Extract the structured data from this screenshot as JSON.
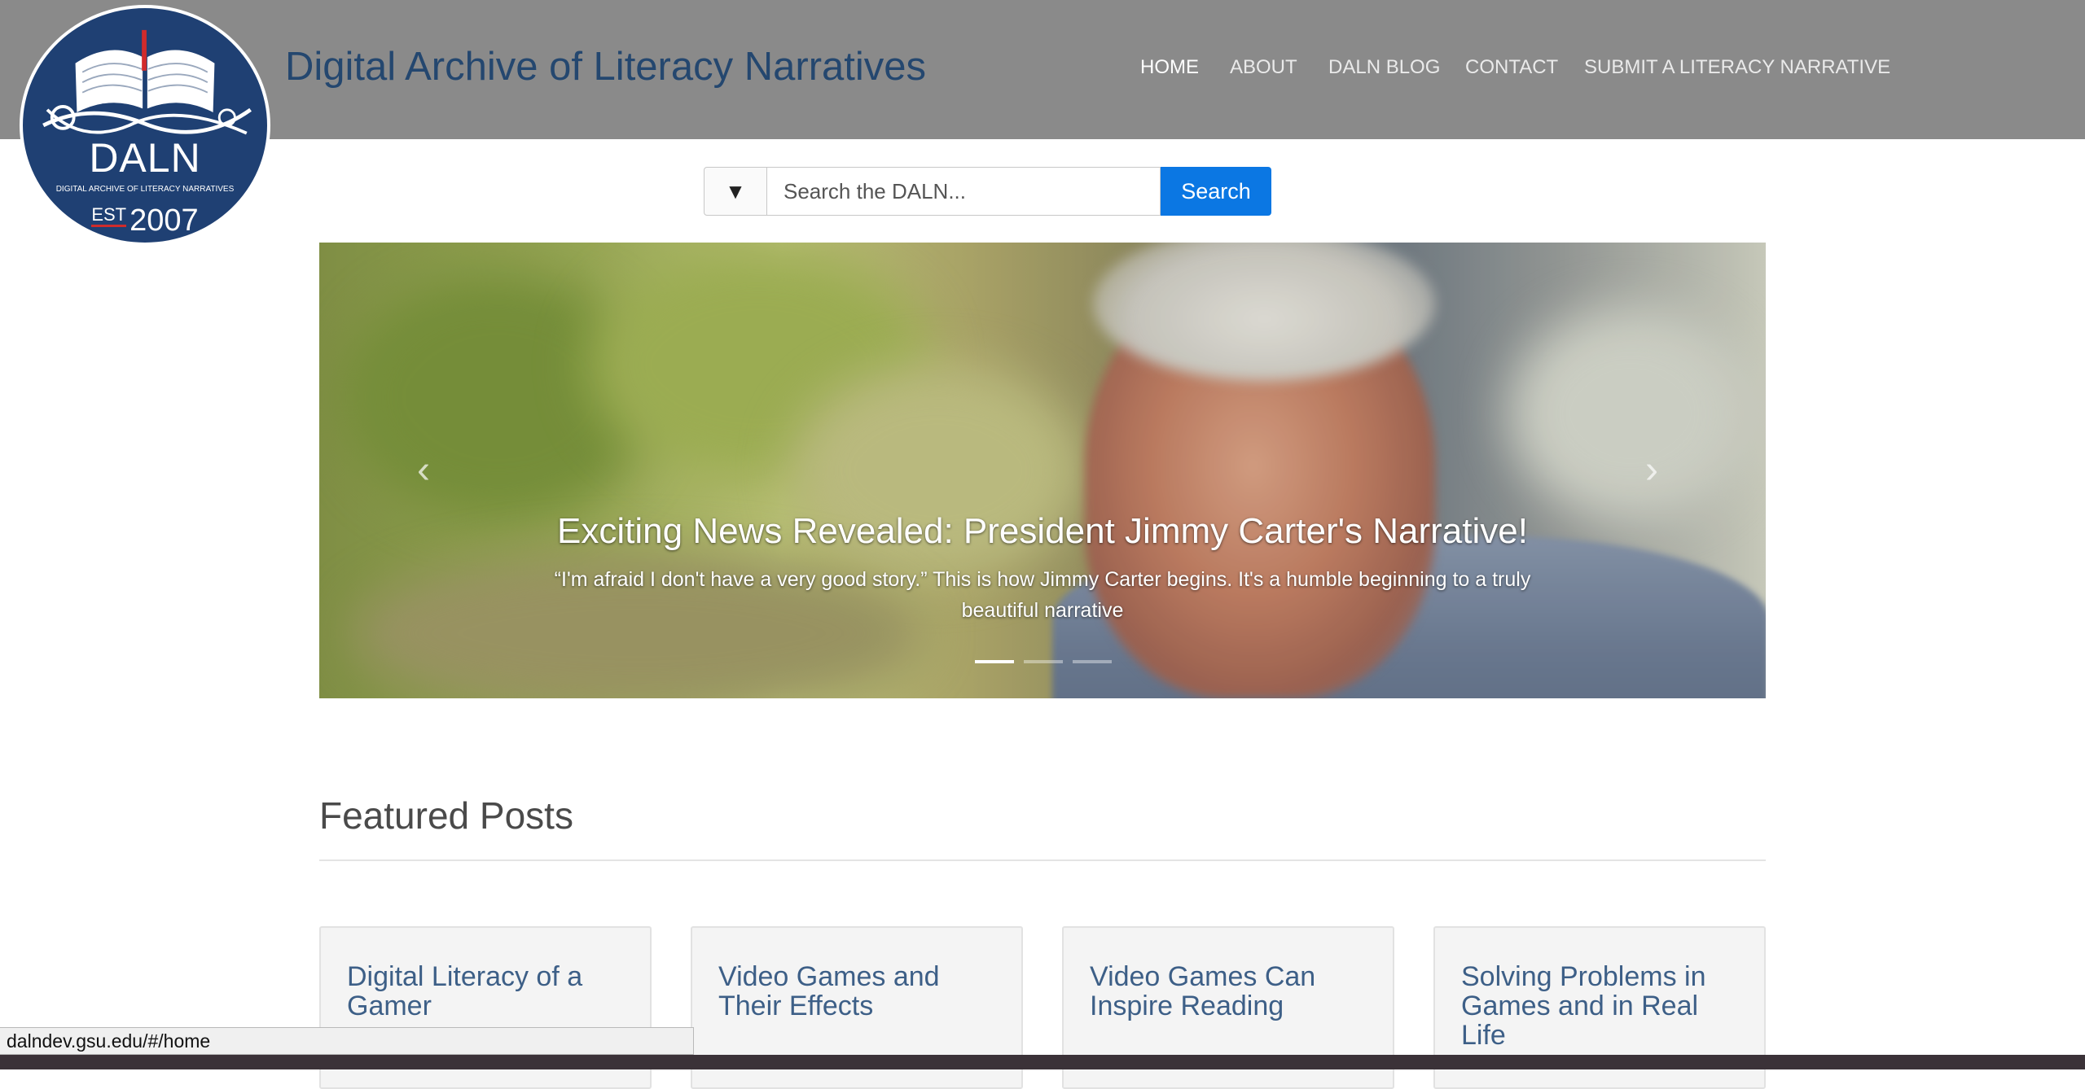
{
  "header": {
    "logo": {
      "main": "DALN",
      "sub": "DIGITAL ARCHIVE OF LITERACY NARRATIVES",
      "est": "EST",
      "year": "2007"
    },
    "site_title": "Digital Archive of Literacy Narratives",
    "nav": [
      {
        "label": "HOME",
        "active": true
      },
      {
        "label": "ABOUT",
        "active": false
      },
      {
        "label": "DALN BLOG",
        "active": false
      },
      {
        "label": "CONTACT",
        "active": false
      },
      {
        "label": "SUBMIT A LITERACY NARRATIVE",
        "active": false
      }
    ]
  },
  "search": {
    "toggle": "▼",
    "placeholder": "Search the DALN...",
    "button": "Search"
  },
  "carousel": {
    "prev": "‹",
    "next": "›",
    "title": "Exciting News Revealed: President Jimmy Carter's Narrative!",
    "text": "“I'm afraid I don't have a very good story.” This is how Jimmy Carter begins. It's a humble beginning to a truly beautiful narrative",
    "slide_count": 3,
    "active_slide": 1
  },
  "featured": {
    "heading": "Featured Posts",
    "cards": [
      {
        "title": "Digital Literacy of a Gamer"
      },
      {
        "title": "Video Games and Their Effects"
      },
      {
        "title": "Video Games Can Inspire Reading"
      },
      {
        "title": "Solving Problems in Games and in Real Life"
      }
    ]
  },
  "status_bar": "dalndev.gsu.edu/#/home",
  "colors": {
    "header_bg": "#8a8a8a",
    "title": "#24476f",
    "accent": "#0b77e3",
    "logo_bg": "#1f4073",
    "card_title": "#3d5f87"
  }
}
